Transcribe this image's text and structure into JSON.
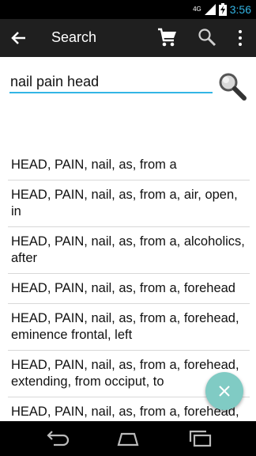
{
  "status_bar": {
    "network": "4G",
    "time": "3:56",
    "icons": [
      "signal-icon",
      "battery-charging-icon"
    ]
  },
  "action_bar": {
    "title": "Search",
    "icons": [
      "back-arrow-icon",
      "cart-icon",
      "search-icon",
      "overflow-menu-icon"
    ]
  },
  "search": {
    "query": "nail pain head"
  },
  "results": [
    "HEAD, PAIN, nail, as, from a",
    "HEAD, PAIN, nail, as, from a, air, open, in",
    "HEAD, PAIN, nail, as, from a, alcoholics, after",
    "HEAD, PAIN, nail, as, from a, forehead",
    "HEAD, PAIN, nail, as, from a, forehead, eminence frontal, left",
    "HEAD, PAIN, nail, as, from a, forehead, extending, from occiput, to",
    "HEAD, PAIN, nail, as, from a, forehead, side, left"
  ],
  "colors": {
    "accent": "#33b5e5",
    "fab": "#80cbc4",
    "action_bar": "#1f1f1f"
  }
}
